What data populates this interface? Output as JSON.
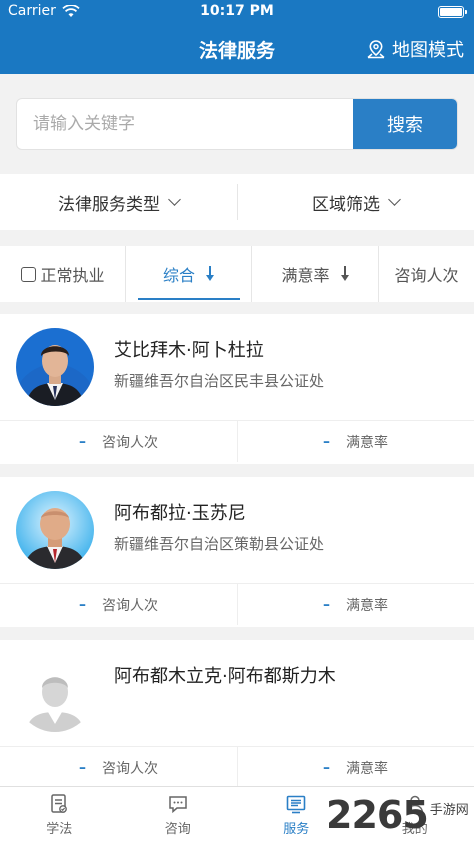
{
  "status_bar": {
    "carrier": "Carrier",
    "time": "10:17 PM"
  },
  "nav": {
    "title": "法律服务",
    "map_mode": "地图模式"
  },
  "search": {
    "placeholder": "请输入关键字",
    "button": "搜索"
  },
  "filters": [
    {
      "label": "法律服务类型"
    },
    {
      "label": "区域筛选"
    }
  ],
  "sort": {
    "checkbox_label": "正常执业",
    "items": [
      {
        "label": "综合",
        "active": true
      },
      {
        "label": "满意率",
        "active": false
      },
      {
        "label": "咨询人次",
        "active": false
      }
    ]
  },
  "cards": [
    {
      "name": "艾比拜木·阿卜杜拉",
      "org": "新疆维吾尔自治区民丰县公证处",
      "consult_value": "–",
      "consult_label": "咨询人次",
      "rate_value": "–",
      "rate_label": "满意率"
    },
    {
      "name": "阿布都拉·玉苏尼",
      "org": "新疆维吾尔自治区策勒县公证处",
      "consult_value": "–",
      "consult_label": "咨询人次",
      "rate_value": "–",
      "rate_label": "满意率"
    },
    {
      "name": "阿布都木立克·阿布都斯力木",
      "org": "",
      "consult_value": "–",
      "consult_label": "咨询人次",
      "rate_value": "–",
      "rate_label": "满意率"
    }
  ],
  "tabs": [
    {
      "label": "学法",
      "icon": "book-icon",
      "active": false
    },
    {
      "label": "咨询",
      "icon": "chat-icon",
      "active": false
    },
    {
      "label": "服务",
      "icon": "service-icon",
      "active": true
    },
    {
      "label": "我的",
      "icon": "user-icon",
      "active": false
    }
  ],
  "watermark": {
    "number": "2265",
    "text": "手游网"
  },
  "colors": {
    "primary": "#1a78c2",
    "accent": "#2a7fc6"
  }
}
